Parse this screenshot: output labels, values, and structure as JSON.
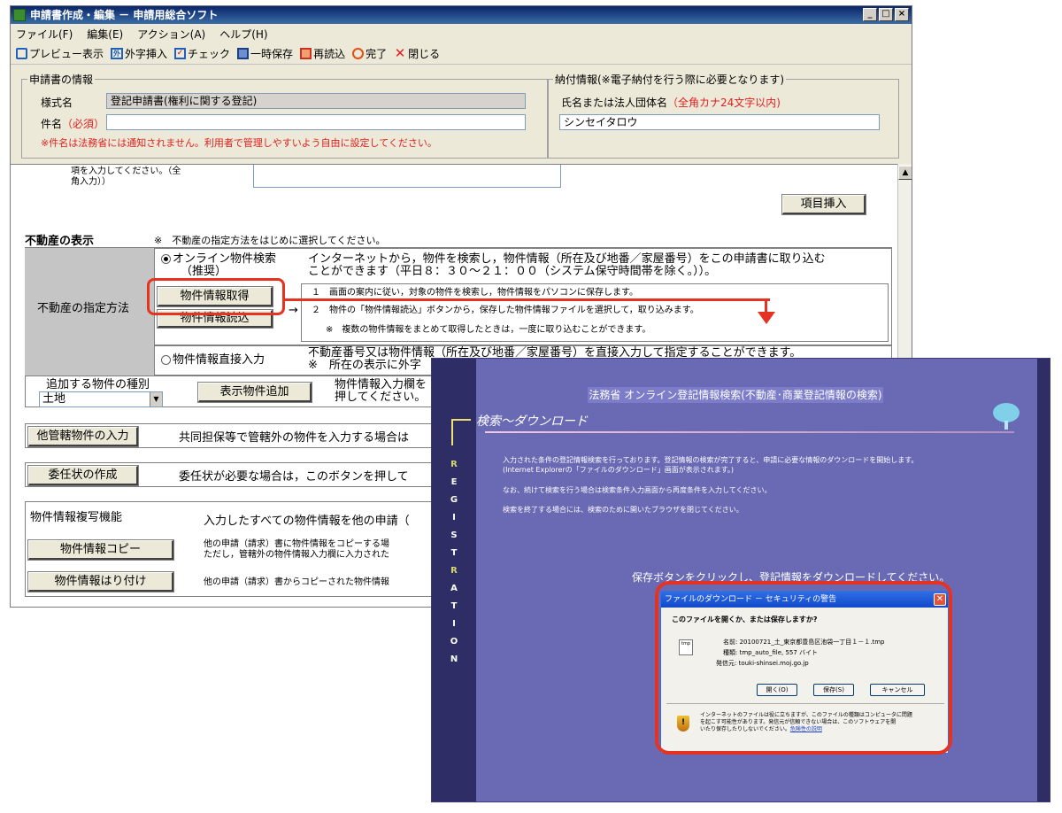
{
  "window": {
    "title": "申請書作成・編集 － 申請用総合ソフト",
    "controls": {
      "minimize": "_",
      "maximize": "□",
      "close": "×"
    }
  },
  "menu": [
    "ファイル(F)",
    "編集(E)",
    "アクション(A)",
    "ヘルプ(H)"
  ],
  "toolbar": {
    "preview": "プレビュー表示",
    "gaiji": "外字挿入",
    "gaiji_icon_text": "外",
    "check": "チェック",
    "temp_save": "一時保存",
    "reload": "再読込",
    "done": "完了",
    "close": "閉じる"
  },
  "app_info": {
    "legend": "申請書の情報",
    "form_name_label": "様式名",
    "form_name_value": "登記申請書(権利に関する登記)",
    "subject_label": "件名",
    "subject_required": "（必須）",
    "subject_value": "",
    "note": "※件名は法務省には通知されません。利用者で管理しやすいよう自由に設定してください。"
  },
  "payment": {
    "legend": "納付情報(※電子納付を行う際に必要となります)",
    "name_label": "氏名または法人団体名",
    "name_hint": "（全角カナ24文字以内)",
    "name_value": "シンセイタロウ"
  },
  "form": {
    "cut_text_1": "項を入力してください。（全",
    "cut_text_2": "角入力））",
    "insert_item_button": "項目挿入",
    "property_heading": "不動産の表示",
    "property_note": "※　不動産の指定方法をはじめに選択してください。",
    "spec_method_label": "不動産の指定方法",
    "online_search_label": "オンライン物件検索",
    "online_search_recommended": "（推奨）",
    "online_desc_1": "インターネットから，物件を検索し，物件情報（所在及び地番／家屋番号）をこの申請書に取り込む",
    "online_desc_2": "ことができます（平日８：３０～２１：００（システム保守時間帯を除く。））。",
    "get_info_button": "物件情報取得",
    "read_info_button": "物件情報読込",
    "arrow": "→",
    "step1": "１　画面の案内に従い，対象の物件を検索し，物件情報をパソコンに保存します。",
    "step2": "２　物件の「物件情報読込」ボタンから，保存した物件情報ファイルを選択して，取り込みます。",
    "step_note": "※　複数の物件情報をまとめて取得したときは，一度に取り込むことができます。",
    "direct_input_label": "物件情報直接入力",
    "direct_desc_1": "不動産番号又は物件情報（所在及び地番／家屋番号）を直接入力して指定することができます。",
    "direct_desc_2": "※　所在の表示に外字",
    "add_type_label": "追加する物件の種別",
    "add_type_value": "土地",
    "show_add_button": "表示物件追加",
    "add_desc_1": "物件情報入力欄を",
    "add_desc_2": "押してください。",
    "other_jurisdiction_button": "他管轄物件の入力",
    "other_jurisdiction_desc": "共同担保等で管轄外の物件を入力する場合は",
    "power_of_attorney_button": "委任状の作成",
    "power_of_attorney_desc": "委任状が必要な場合は，このボタンを押して",
    "copy_section_title": "物件情報複写機能",
    "copy_section_desc": "入力したすべての物件情報を他の申請（",
    "copy_button": "物件情報コピー",
    "copy_desc_1": "他の申請（請求）書に物件情報をコピーする場",
    "copy_desc_2": "ただし，管轄外の物件情報入力欄に入力された",
    "paste_button": "物件情報はり付け",
    "paste_desc": "他の申請（請求）書からコピーされた物件情報"
  },
  "web": {
    "header": "法務省 オンライン登記情報検索(不動産･商業登記情報の検索)",
    "subtitle": "検索～ダウンロード",
    "side_letters": [
      "R",
      "E",
      "G",
      "I",
      "S",
      "T",
      "R",
      "A",
      "T",
      "I",
      "O",
      "N"
    ],
    "para1_1": "入力された条件の登記情報検索を行っております。登記情報の検索が完了すると、申請に必要な情報のダウンロードを開始します。",
    "para1_2": "(Internet Explorerの「ファイルのダウンロード」画面が表示されます。)",
    "para2": "なお、続けて検索を行う場合は検索条件入力画面から再度条件を入力してください。",
    "para3": "検索を終了する場合には、検索のために開いたブラウザを閉じてください。",
    "save_instruction": "保存ボタンをクリックし、登記情報をダウンロードしてください。"
  },
  "dialog": {
    "title": "ファイルのダウンロード － セキュリティの警告",
    "question": "このファイルを開くか、または保存しますか?",
    "file_icon_text": "tmp",
    "name_label": "名前:",
    "name_value": "20100721_土_東京都豊島区池袋一丁目１－１.tmp",
    "type_label": "種類:",
    "type_value": "tmp_auto_file, 557 バイト",
    "from_label": "発信元:",
    "from_value": "touki-shinsei.moj.go.jp",
    "open_button": "開く(O)",
    "save_button": "保存(S)",
    "cancel_button": "キャンセル",
    "warning_1": "インターネットのファイルは役に立ちますが、このファイルの種類はコンピュータに問題",
    "warning_2": "を起こす可能性があります。発信元が信頼できない場合は、このソフトウェアを開",
    "warning_3": "いたり保存したりしないでください。",
    "risk_link": "危険性の説明"
  }
}
